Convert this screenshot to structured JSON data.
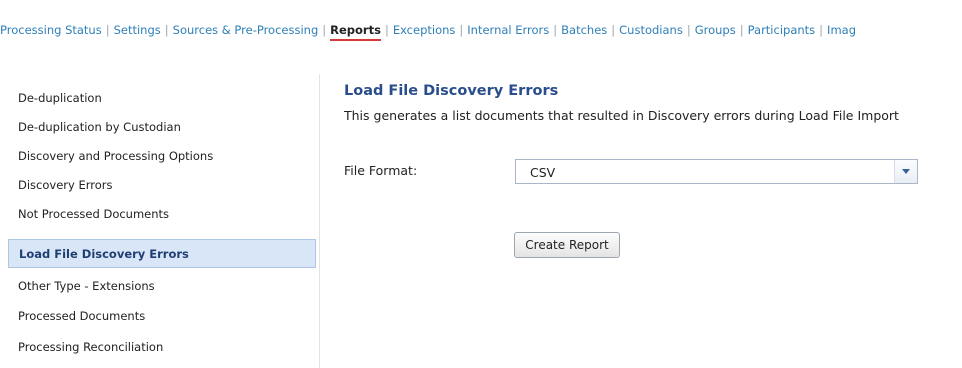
{
  "nav": {
    "tabs": [
      {
        "label": "Processing Status"
      },
      {
        "label": "Settings"
      },
      {
        "label": "Sources & Pre-Processing"
      },
      {
        "label": "Reports",
        "active": true
      },
      {
        "label": "Exceptions"
      },
      {
        "label": "Internal Errors"
      },
      {
        "label": "Batches"
      },
      {
        "label": "Custodians"
      },
      {
        "label": "Groups"
      },
      {
        "label": "Participants"
      },
      {
        "label": "Imag"
      }
    ],
    "separator": "|",
    "link_color": "#2f7fb8",
    "active_underline_color": "#d63a3a"
  },
  "sidebar": {
    "items": [
      {
        "label": "De-duplication"
      },
      {
        "label": "De-duplication by Custodian"
      },
      {
        "label": "Discovery and Processing Options"
      },
      {
        "label": "Discovery Errors"
      },
      {
        "label": "Not Processed Documents"
      },
      {
        "label": "Load File Discovery Errors",
        "selected": true
      },
      {
        "label": "Other Type - Extensions"
      },
      {
        "label": "Processed Documents"
      },
      {
        "label": "Processing Reconciliation"
      }
    ],
    "selected_bg": "#d9e6f7"
  },
  "main": {
    "title": "Load File Discovery Errors",
    "description": "This generates a list documents that resulted in Discovery errors during Load File Import",
    "file_format_label": "File Format:",
    "file_format_value": "CSV",
    "dropdown_icon": "chevron-down-icon",
    "create_button": "Create Report",
    "title_color": "#2a4e8c"
  }
}
